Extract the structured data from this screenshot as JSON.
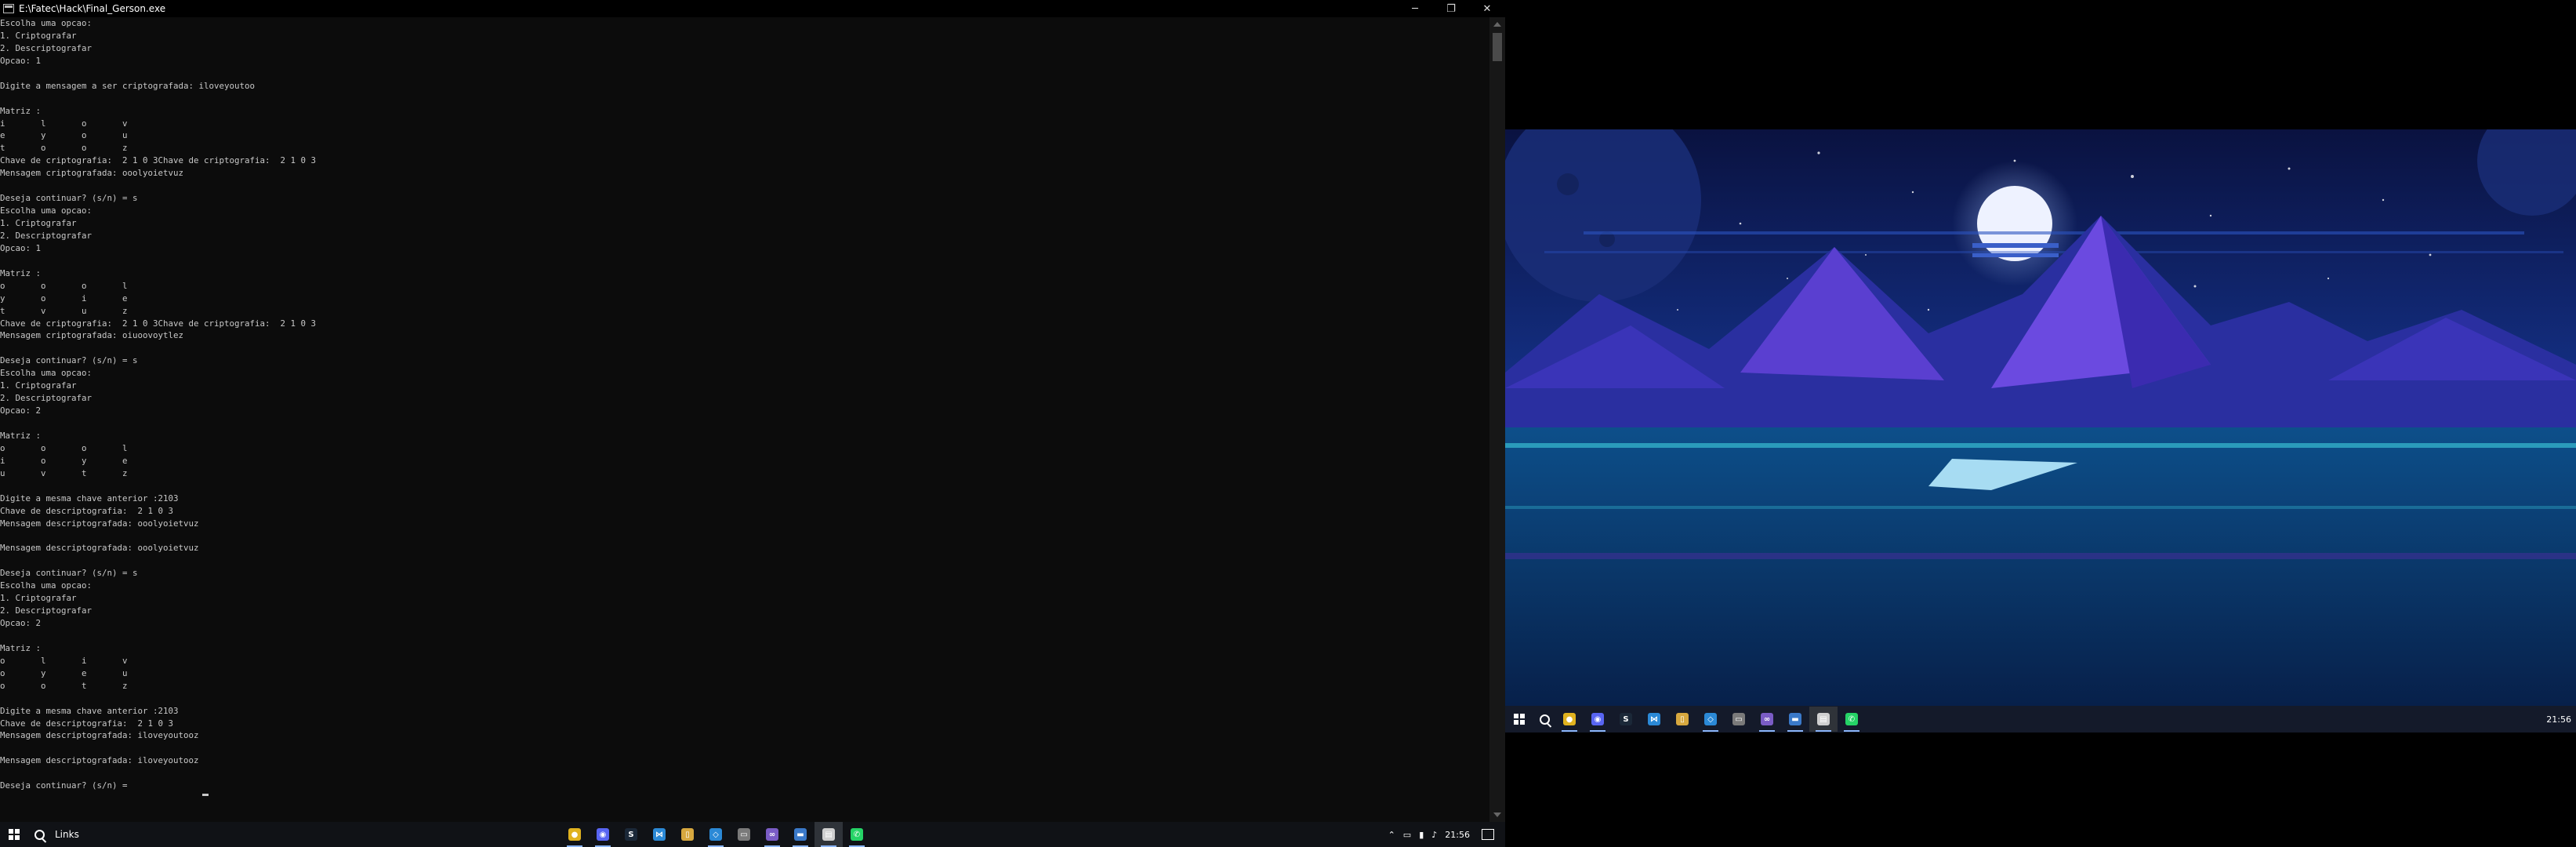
{
  "window": {
    "title": "E:\\Fatec\\Hack\\Final_Gerson.exe",
    "minimize_glyph": "─",
    "restore_glyph": "❐",
    "close_glyph": "✕"
  },
  "console": {
    "lines": [
      "Escolha uma opcao:",
      "1. Criptografar",
      "2. Descriptografar",
      "Opcao: 1",
      "",
      "Digite a mensagem a ser criptografada: iloveyoutoo",
      "",
      "Matriz :",
      "i       l       o       v",
      "e       y       o       u",
      "t       o       o       z",
      "Chave de criptografia:  2 1 0 3Chave de criptografia:  2 1 0 3",
      "Mensagem criptografada: ooolyoietvuz",
      "",
      "Deseja continuar? (s/n) = s",
      "Escolha uma opcao:",
      "1. Criptografar",
      "2. Descriptografar",
      "Opcao: 1",
      "",
      "Matriz :",
      "o       o       o       l",
      "y       o       i       e",
      "t       v       u       z",
      "Chave de criptografia:  2 1 0 3Chave de criptografia:  2 1 0 3",
      "Mensagem criptografada: oiuoovoytlez",
      "",
      "Deseja continuar? (s/n) = s",
      "Escolha uma opcao:",
      "1. Criptografar",
      "2. Descriptografar",
      "Opcao: 2",
      "",
      "Matriz :",
      "o       o       o       l",
      "i       o       y       e",
      "u       v       t       z",
      "",
      "Digite a mesma chave anterior :2103",
      "Chave de descriptografia:  2 1 0 3",
      "Mensagem descriptografada: ooolyoietvuz",
      "",
      "Mensagem descriptografada: ooolyoietvuz",
      "",
      "Deseja continuar? (s/n) = s",
      "Escolha uma opcao:",
      "1. Criptografar",
      "2. Descriptografar",
      "Opcao: 2",
      "",
      "Matriz :",
      "o       l       i       v",
      "o       y       e       u",
      "o       o       t       z",
      "",
      "Digite a mesma chave anterior :2103",
      "Chave de descriptografia:  2 1 0 3",
      "Mensagem descriptografada: iloveyoutooz",
      "",
      "Mensagem descriptografada: iloveyoutooz",
      "",
      "Deseja continuar? (s/n) = "
    ]
  },
  "taskbar_left": {
    "links_label": "Links",
    "apps": [
      {
        "icon": "chrome-icon",
        "color": "#e0b21f",
        "glyph": "●"
      },
      {
        "icon": "discord-icon",
        "color": "#5865f2",
        "glyph": "◉"
      },
      {
        "icon": "steam-icon",
        "color": "#1b2838",
        "glyph": "S"
      },
      {
        "icon": "vscode-icon",
        "color": "#2b89d6",
        "glyph": "⋈"
      },
      {
        "icon": "zip-icon",
        "color": "#d7a83f",
        "glyph": "▯"
      },
      {
        "icon": "visualstudio-icon",
        "color": "#2b89d6",
        "glyph": "◇"
      },
      {
        "icon": "folder-icon",
        "color": "#7a7a7a",
        "glyph": "▭"
      },
      {
        "icon": "vs-purple-icon",
        "color": "#7a5cc5",
        "glyph": "∞"
      },
      {
        "icon": "explorer-icon",
        "color": "#3a79c9",
        "glyph": "▬"
      },
      {
        "icon": "terminal-icon",
        "color": "#cfcfcf",
        "glyph": "▤"
      },
      {
        "icon": "whatsapp-icon",
        "color": "#25d366",
        "glyph": "✆"
      }
    ],
    "clock": "21:56"
  },
  "taskbar_right": {
    "clock": "21:56",
    "apps": [
      {
        "icon": "chrome-icon",
        "color": "#e0b21f",
        "glyph": "●"
      },
      {
        "icon": "discord-icon",
        "color": "#5865f2",
        "glyph": "◉"
      },
      {
        "icon": "steam-icon",
        "color": "#1b2838",
        "glyph": "S"
      },
      {
        "icon": "vscode-icon",
        "color": "#2b89d6",
        "glyph": "⋈"
      },
      {
        "icon": "zip-icon",
        "color": "#d7a83f",
        "glyph": "▯"
      },
      {
        "icon": "visualstudio-icon",
        "color": "#2b89d6",
        "glyph": "◇"
      },
      {
        "icon": "folder-icon",
        "color": "#7a7a7a",
        "glyph": "▭"
      },
      {
        "icon": "vs-purple-icon",
        "color": "#7a5cc5",
        "glyph": "∞"
      },
      {
        "icon": "explorer-icon",
        "color": "#3a79c9",
        "glyph": "▬"
      },
      {
        "icon": "terminal-icon",
        "color": "#cfcfcf",
        "glyph": "▤"
      },
      {
        "icon": "whatsapp-icon",
        "color": "#25d366",
        "glyph": "✆"
      }
    ]
  },
  "colors": {
    "console_bg": "#0c0c0c",
    "console_text": "#c8c8c8",
    "taskbar": "#101216",
    "sky_top": "#0a1240",
    "sky_bottom": "#1a3a9a"
  }
}
